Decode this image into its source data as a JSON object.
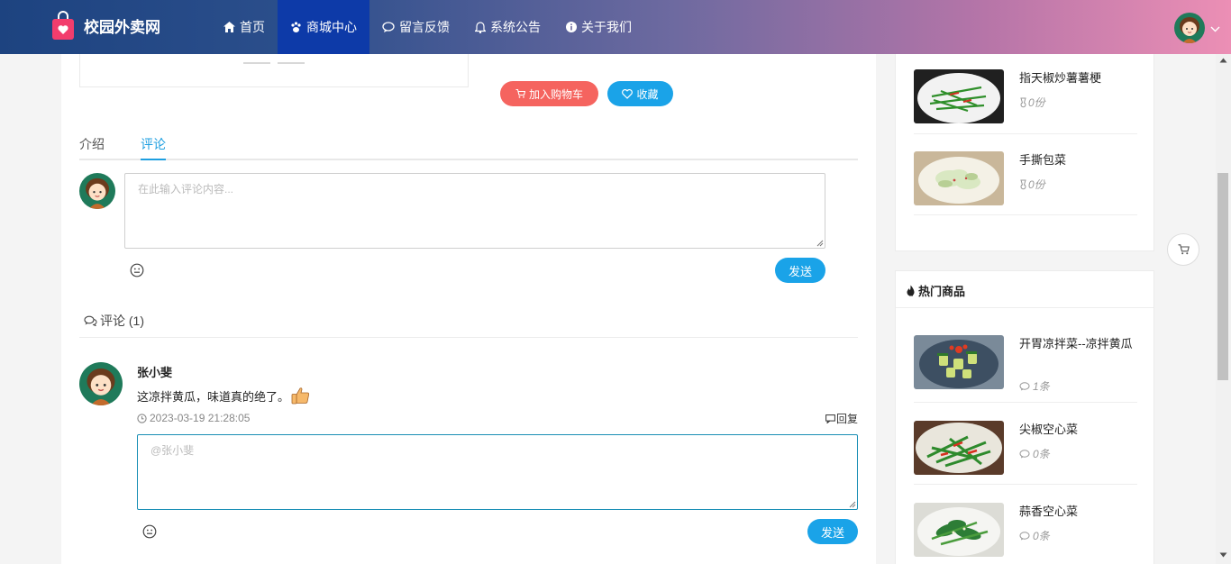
{
  "app": {
    "title": "校园外卖网"
  },
  "nav": {
    "items": [
      {
        "label": "首页",
        "icon": "home-icon"
      },
      {
        "label": "商城中心",
        "icon": "paw-icon",
        "active": true
      },
      {
        "label": "留言反馈",
        "icon": "chat-icon"
      },
      {
        "label": "系统公告",
        "icon": "bell-icon"
      },
      {
        "label": "关于我们",
        "icon": "info-icon"
      }
    ]
  },
  "product": {
    "add_to_cart_label": "加入购物车",
    "favorite_label": "收藏"
  },
  "tabs": [
    {
      "label": "介绍"
    },
    {
      "label": "评论",
      "active": true
    }
  ],
  "comment_form": {
    "placeholder": "在此输入评论内容...",
    "send_label": "发送"
  },
  "comments_header": {
    "label": "评论 (1)"
  },
  "comments": [
    {
      "author": "张小斐",
      "text": "这凉拌黄瓜，味道真的绝了。",
      "time": "2023-03-19 21:28:05",
      "reply_label": "回复",
      "reply_placeholder": "@张小斐",
      "reply_send_label": "发送"
    }
  ],
  "sidebar": {
    "recommended": [
      {
        "name": "指天椒炒薯薯梗",
        "meta": "0份"
      },
      {
        "name": "手撕包菜",
        "meta": "0份"
      }
    ],
    "hot_title": "热门商品",
    "hot": [
      {
        "name": "开胃凉拌菜--凉拌黄瓜",
        "meta": "1条"
      },
      {
        "name": "尖椒空心菜",
        "meta": "0条"
      },
      {
        "name": "蒜香空心菜",
        "meta": "0条"
      }
    ]
  },
  "colors": {
    "accent_blue": "#1aa3e8",
    "cart_red": "#f5645f",
    "nav_active": "#0d3aa8"
  }
}
